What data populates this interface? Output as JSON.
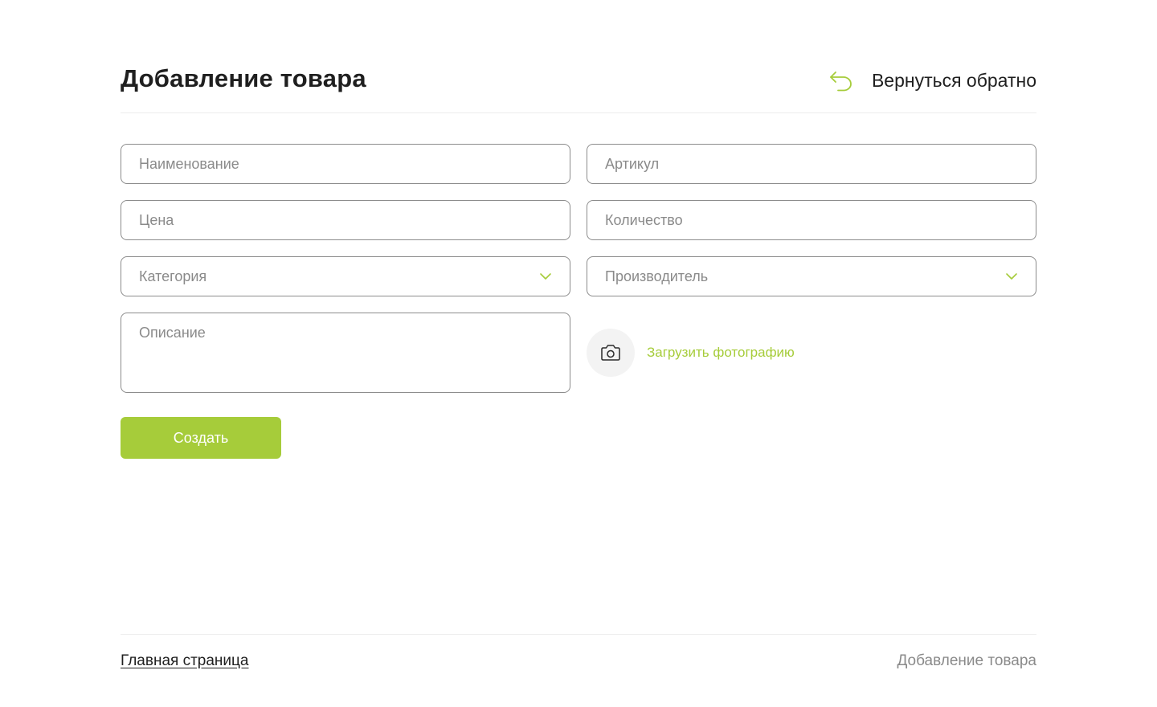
{
  "header": {
    "title": "Добавление товара",
    "back_label": "Вернуться обратно",
    "back_icon": "undo-arrow-icon"
  },
  "form": {
    "name_placeholder": "Наименование",
    "article_placeholder": "Артикул",
    "price_placeholder": "Цена",
    "quantity_placeholder": "Количество",
    "category_placeholder": "Категория",
    "manufacturer_placeholder": "Производитель",
    "description_placeholder": "Описание",
    "upload_label": "Загрузить фотографию",
    "upload_icon": "camera-icon",
    "submit_label": "Создать"
  },
  "breadcrumb": {
    "home": "Главная страница",
    "current": "Добавление товара"
  },
  "colors": {
    "accent": "#a6cc3a",
    "text": "#1f1f1f",
    "muted": "#8a8a8a",
    "border": "#8c8c8c"
  }
}
